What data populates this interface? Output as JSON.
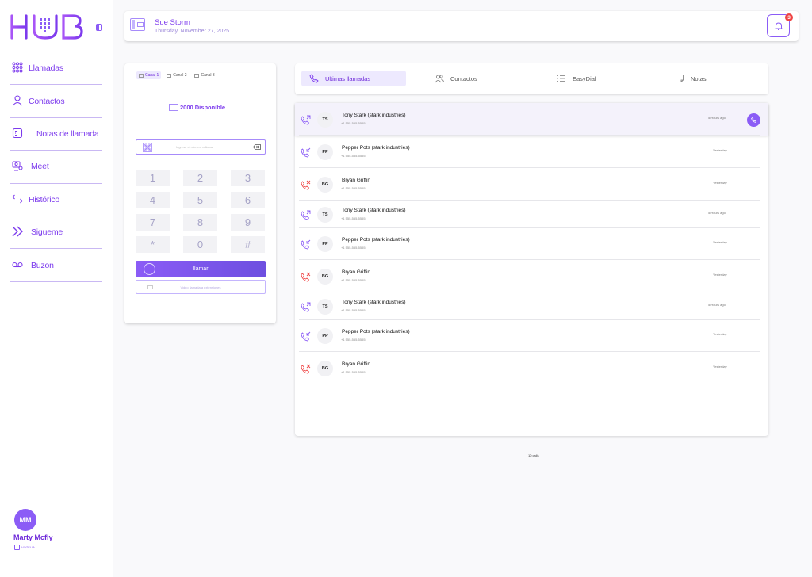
{
  "brand": {
    "logo_text": "HUB",
    "accent": "#8b5cf6"
  },
  "sidebar": {
    "items": [
      {
        "label": "Llamadas",
        "icon": "dialpad-icon"
      },
      {
        "label": "Contactos",
        "icon": "person-icon"
      },
      {
        "label": "Notas de llamada",
        "icon": "notes-icon"
      },
      {
        "label": "Meet",
        "icon": "meet-icon"
      },
      {
        "label": "Histórico",
        "icon": "swap-arrows-icon"
      },
      {
        "label": "Sigueme",
        "icon": "double-chevron-right-icon"
      },
      {
        "label": "Buzon",
        "icon": "voicemail-icon"
      }
    ],
    "profile": {
      "initials": "MM",
      "name": "Marty Mcfly",
      "brand": "VOZELIA"
    }
  },
  "header": {
    "name": "Sue Storm",
    "date": "Thursday, November 27, 2025",
    "notifications": "3"
  },
  "dialer": {
    "channels": [
      "Canal 1",
      "Canal 2",
      "Canal 3"
    ],
    "available": "2000 Disponible",
    "input_placeholder": "Ingrese el número a llamar",
    "keys": [
      "1",
      "2",
      "3",
      "4",
      "5",
      "6",
      "7",
      "8",
      "9",
      "*",
      "0",
      "#"
    ],
    "call_label": "llamar",
    "video_label": "Video llamada a extensiones"
  },
  "tabs": [
    {
      "label": "Ultimas llamadas",
      "icon": "phone-icon"
    },
    {
      "label": "Contactos",
      "icon": "people-icon"
    },
    {
      "label": "EasyDial",
      "icon": "list-icon"
    },
    {
      "label": "Notas",
      "icon": "note-icon"
    }
  ],
  "calls": [
    {
      "initials": "TS",
      "name": "Tony Stark (stark industries)",
      "number": "+1 555-555-5555",
      "time": "5 Hours ago",
      "direction": "outgoing"
    },
    {
      "initials": "PP",
      "name": "Pepper Pots (stark industries)",
      "number": "+1 555-555-5555",
      "time": "Yesterday",
      "direction": "incoming"
    },
    {
      "initials": "BG",
      "name": "Bryan Griffin",
      "number": "+1 555-555-5555",
      "time": "Yesterday",
      "direction": "missed"
    },
    {
      "initials": "TS",
      "name": "Tony Stark (stark industries)",
      "number": "+1 555-555-5555",
      "time": "5 Hours ago",
      "direction": "outgoing"
    },
    {
      "initials": "PP",
      "name": "Pepper Pots (stark industries)",
      "number": "+1 555-555-5555",
      "time": "Yesterday",
      "direction": "incoming"
    },
    {
      "initials": "BG",
      "name": "Bryan Griffin",
      "number": "+1 555-555-5555",
      "time": "Yesterday",
      "direction": "missed"
    },
    {
      "initials": "TS",
      "name": "Tony Stark (stark industries)",
      "number": "+1 555-555-5555",
      "time": "5 Hours ago",
      "direction": "outgoing"
    },
    {
      "initials": "PP",
      "name": "Pepper Pots (stark industries)",
      "number": "+1 555-555-5555",
      "time": "Yesterday",
      "direction": "incoming"
    },
    {
      "initials": "BG",
      "name": "Bryan Griffin",
      "number": "+1 555-555-5555",
      "time": "Yesterday",
      "direction": "missed"
    }
  ],
  "footer": "10 calls"
}
